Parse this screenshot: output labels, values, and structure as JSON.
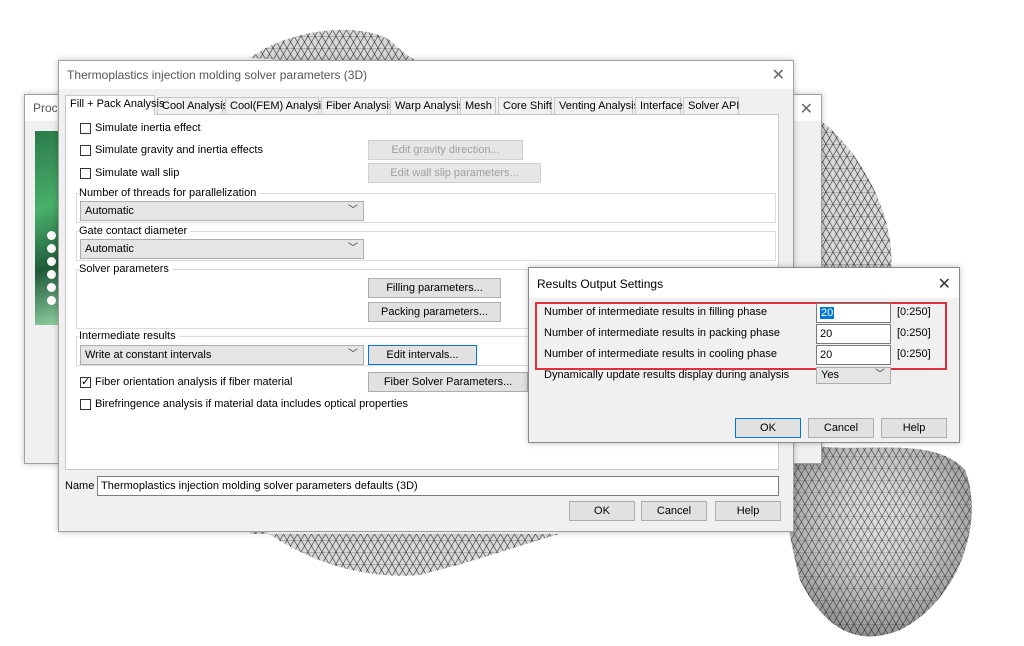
{
  "process_window": {
    "title": "Proce"
  },
  "main_dialog": {
    "title": "Thermoplastics injection molding solver parameters (3D)",
    "tabs": [
      "Fill + Pack Analysis",
      "Cool Analysis",
      "Cool(FEM) Analysis",
      "Fiber Analysis",
      "Warp Analysis",
      "Mesh",
      "Core Shift",
      "Venting Analysis",
      "Interface",
      "Solver API"
    ],
    "simulate_inertia": "Simulate inertia effect",
    "simulate_gravity": "Simulate gravity and inertia effects",
    "edit_gravity": "Edit gravity direction...",
    "simulate_wall_slip": "Simulate wall slip",
    "edit_wall_slip": "Edit wall slip parameters...",
    "threads_label": "Number of threads for parallelization",
    "threads_value": "Automatic",
    "gate_label": "Gate contact diameter",
    "gate_value": "Automatic",
    "solver_params_label": "Solver parameters",
    "filling_params": "Filling parameters...",
    "packing_params": "Packing parameters...",
    "intermediate_label": "Intermediate results",
    "intermediate_value": "Write at constant intervals",
    "edit_intervals": "Edit intervals...",
    "fiber_orientation": "Fiber orientation analysis if fiber material",
    "fiber_solver": "Fiber Solver Parameters...",
    "birefringence": "Birefringence analysis if material data includes optical properties",
    "name_label": "Name",
    "name_value": "Thermoplastics injection molding solver parameters defaults (3D)",
    "ok": "OK",
    "cancel": "Cancel",
    "help": "Help"
  },
  "results_dialog": {
    "title": "Results Output Settings",
    "rows": [
      {
        "label": "Number of intermediate results in filling phase",
        "value": "20",
        "range": "[0:250]"
      },
      {
        "label": "Number of intermediate results in packing phase",
        "value": "20",
        "range": "[0:250]"
      },
      {
        "label": "Number of intermediate results in cooling phase",
        "value": "20",
        "range": "[0:250]"
      }
    ],
    "dynamic_label": "Dynamically update results display during analysis",
    "dynamic_value": "Yes",
    "ok": "OK",
    "cancel": "Cancel",
    "help": "Help",
    "highlight_color": "#e0303a"
  }
}
